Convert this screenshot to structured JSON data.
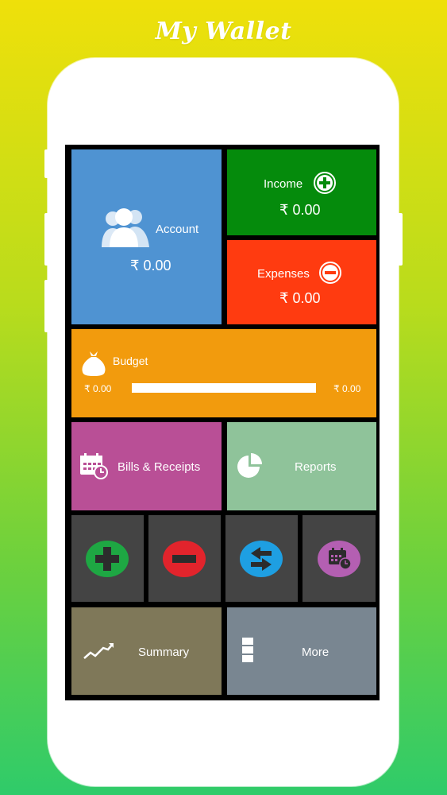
{
  "app_title": "My Wallet",
  "currency_symbol": "₹",
  "tiles": {
    "account": {
      "label": "Account",
      "amount": "₹ 0.00",
      "color": "#4f93d2"
    },
    "income": {
      "label": "Income",
      "amount": "₹ 0.00",
      "color": "#058b0c"
    },
    "expenses": {
      "label": "Expenses",
      "amount": "₹ 0.00",
      "color": "#ff3b10"
    },
    "budget": {
      "label": "Budget",
      "min_amount": "₹ 0.00",
      "max_amount": "₹ 0.00",
      "progress": 0,
      "color": "#f29b0d"
    },
    "bills": {
      "label": "Bills & Receipts",
      "color": "#b94f96"
    },
    "reports": {
      "label": "Reports",
      "color": "#8fc39a"
    },
    "summary": {
      "label": "Summary",
      "color": "#7f7859"
    },
    "more": {
      "label": "More",
      "color": "#798691"
    }
  },
  "quick_actions": [
    {
      "name": "add-income",
      "icon": "plus-icon",
      "color": "#1ea743"
    },
    {
      "name": "add-expense",
      "icon": "minus-icon",
      "color": "#e2242c"
    },
    {
      "name": "transfer",
      "icon": "transfer-arrows-icon",
      "color": "#1e9fe2"
    },
    {
      "name": "schedule",
      "icon": "calendar-clock-icon",
      "color": "#b45fb2"
    }
  ],
  "quick_action_tile_color": "#444444"
}
